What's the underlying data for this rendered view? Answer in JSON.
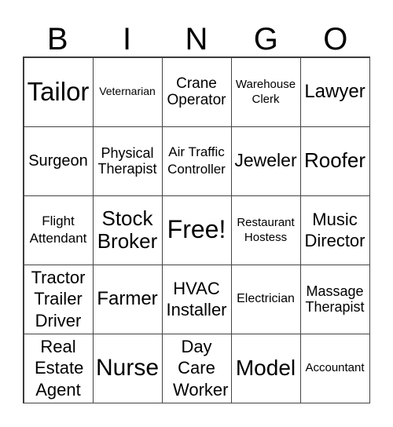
{
  "header": [
    "B",
    "I",
    "N",
    "G",
    "O"
  ],
  "cells": [
    "Tailor",
    "Veternarian",
    "Crane Operator",
    "Warehouse Clerk",
    "Lawyer",
    "Surgeon",
    "Physical Therapist",
    "Air Traffic Controller",
    "Jeweler",
    "Roofer",
    "Flight Attendant",
    "Stock Broker",
    "Free!",
    "Restaurant Hostess",
    "Music Director",
    "Tractor Trailer Driver",
    "Farmer",
    "HVAC Installer",
    "Electrician",
    "Massage Therapist",
    "Real Estate Agent",
    "Nurse",
    "Day Care Worker",
    "Model",
    "Accountant"
  ]
}
